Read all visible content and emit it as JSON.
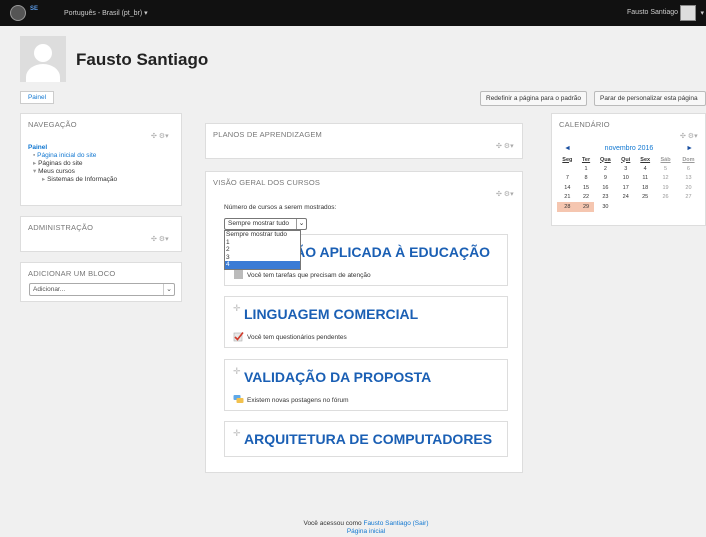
{
  "topbar": {
    "logo_text": "SE",
    "language": "Português - Brasil (pt_br) ▾",
    "user": "Fausto Santiago",
    "menu_caret": "▾"
  },
  "header": {
    "name": "Fausto Santiago"
  },
  "tabs": {
    "painel": "Painel"
  },
  "buttons": {
    "reset": "Redefinir a página para o padrão",
    "stop": "Parar de personalizar esta página"
  },
  "block_controls": "✣ ⚙▾",
  "navigation": {
    "title": "NAVEGAÇÃO",
    "root": "Painel",
    "items": [
      {
        "bullet": "▪",
        "label": "Página inicial do site"
      },
      {
        "bullet": "▸",
        "label": "Páginas do site"
      },
      {
        "bullet": "▾",
        "label": "Meus cursos"
      },
      {
        "bullet": "▸",
        "label": "Sistemas de Informação"
      }
    ]
  },
  "administration": {
    "title": "ADMINISTRAÇÃO"
  },
  "add_block": {
    "title": "ADICIONAR UM BLOCO",
    "select_value": "Adicionar..."
  },
  "learning_plans": {
    "title": "PLANOS DE APRENDIZAGEM"
  },
  "course_overview": {
    "title": "VISÃO GERAL DOS CURSOS",
    "count_label": "Número de cursos a serem mostrados:",
    "count_selected": "Sempre mostrar tudo",
    "count_options": [
      "Sempre mostrar tudo",
      "1",
      "2",
      "3",
      "4"
    ],
    "count_highlight": "4",
    "courses": [
      {
        "name": "TECNOLOGIA DA INFORMAÇÃO APLICADA À EDUCAÇÃO",
        "visible_name": "ÇÃO APLICADA À EDUCAÇÃO",
        "note": "Você tem tarefas que precisam de atenção",
        "icon": "assignment-icon"
      },
      {
        "name": "LINGUAGEM COMERCIAL",
        "note": "Você tem questionários pendentes",
        "icon": "quiz-icon"
      },
      {
        "name": "VALIDAÇÃO DA PROPOSTA",
        "note": "Existem novas postagens no fórum",
        "icon": "forum-icon"
      },
      {
        "name": "ARQUITETURA DE COMPUTADORES",
        "note": "",
        "icon": ""
      }
    ]
  },
  "calendar": {
    "title": "CALENDÁRIO",
    "month": "novembro 2016",
    "prev": "◄",
    "next": "►",
    "weekdays": [
      "Seg",
      "Ter",
      "Qua",
      "Qui",
      "Sex",
      "Sáb",
      "Dom"
    ],
    "weeks": [
      [
        "",
        "1",
        "2",
        "3",
        "4",
        "5",
        "6"
      ],
      [
        "7",
        "8",
        "9",
        "10",
        "11",
        "12",
        "13"
      ],
      [
        "14",
        "15",
        "16",
        "17",
        "18",
        "19",
        "20"
      ],
      [
        "21",
        "22",
        "23",
        "24",
        "25",
        "26",
        "27"
      ],
      [
        "28",
        "29",
        "30",
        "",
        "",
        "",
        ""
      ]
    ],
    "highlighted_days": [
      "28",
      "29"
    ]
  },
  "footer": {
    "prefix": "Você acessou como",
    "user": "Fausto Santiago",
    "logout": "(Sair)",
    "home": "Página inicial"
  }
}
